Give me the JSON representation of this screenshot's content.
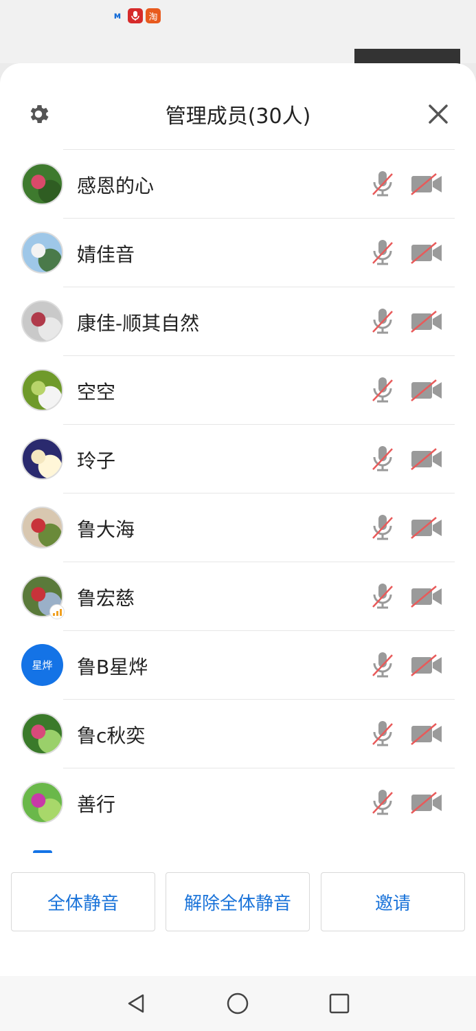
{
  "status_bar": {
    "icons": [
      {
        "name": "app-logo-icon",
        "glyph": "ᴍ"
      },
      {
        "name": "mic-app-icon",
        "glyph": "●"
      },
      {
        "name": "taobao-icon",
        "glyph": "淘"
      }
    ]
  },
  "header": {
    "title": "管理成员(30人)",
    "settings_icon": "gear-icon",
    "close_icon": "close-icon"
  },
  "members": [
    {
      "name": "感恩的心",
      "avatar_colors": [
        "#3e7a2e",
        "#d94a6a",
        "#2f5d22"
      ],
      "mic": "muted",
      "camera": "off"
    },
    {
      "name": "婧佳音",
      "avatar_colors": [
        "#9ec7e8",
        "#f3f3f3",
        "#4a7a4a"
      ],
      "mic": "muted",
      "camera": "off"
    },
    {
      "name": "康佳-顺其自然",
      "avatar_colors": [
        "#c9c9c9",
        "#b03a4a",
        "#e8e8e8"
      ],
      "mic": "muted",
      "camera": "off"
    },
    {
      "name": "空空",
      "avatar_colors": [
        "#6f9a2a",
        "#b8d46a",
        "#f4f4f4"
      ],
      "mic": "muted",
      "camera": "off"
    },
    {
      "name": "玲子",
      "avatar_colors": [
        "#2a2a6e",
        "#f4e7c0",
        "#fff6d8"
      ],
      "mic": "muted",
      "camera": "off"
    },
    {
      "name": "鲁大海",
      "avatar_colors": [
        "#d8c7b0",
        "#c8333a",
        "#6a8a3a"
      ],
      "mic": "muted",
      "camera": "off"
    },
    {
      "name": "鲁宏慈",
      "avatar_colors": [
        "#5a7a3a",
        "#c8333a",
        "#9ab0c8"
      ],
      "mic": "muted",
      "camera": "off",
      "has_signal_badge": true
    },
    {
      "name": "鲁B星烨",
      "avatar_text": "星烨",
      "avatar_bg": "#1473e6",
      "mic": "muted",
      "camera": "off"
    },
    {
      "name": "鲁c秋奕",
      "avatar_colors": [
        "#3a7a2a",
        "#d84a7a",
        "#9ad06a"
      ],
      "mic": "muted",
      "camera": "off"
    },
    {
      "name": "善行",
      "avatar_colors": [
        "#6ab84a",
        "#c83aa8",
        "#a8d86a"
      ],
      "mic": "muted",
      "camera": "off"
    }
  ],
  "actions": {
    "mute_all": "全体静音",
    "unmute_all": "解除全体静音",
    "invite": "邀请"
  },
  "colors": {
    "accent": "#1a73d9",
    "muted_slash": "#e85a5a",
    "icon_gray": "#9a9a9a"
  }
}
